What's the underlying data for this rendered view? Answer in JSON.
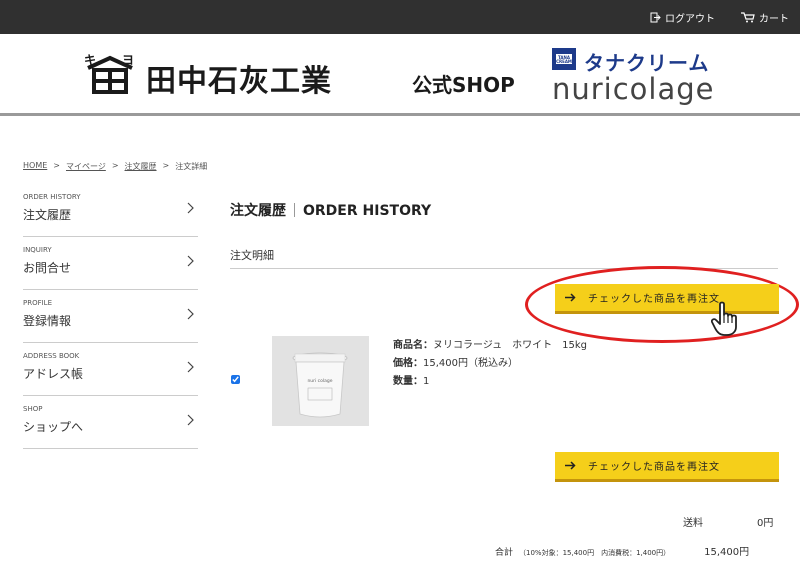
{
  "topbar": {
    "logout_label": "ログアウト",
    "cart_label": "カート"
  },
  "header": {
    "brand_mark_text": "キヨ",
    "brand_name": "田中石灰工業",
    "brand_shop": "公式SHOP",
    "tana_logo_text": "TANA CREAM",
    "tana_katakana": "タナクリーム",
    "nuricolage": "nuricolage"
  },
  "breadcrumb": {
    "items": [
      "HOME",
      "マイページ",
      "注文履歴",
      "注文詳細"
    ],
    "separator": ">"
  },
  "sidebar": {
    "items": [
      {
        "en": "ORDER HISTORY",
        "jp": "注文履歴"
      },
      {
        "en": "INQUIRY",
        "jp": "お問合せ"
      },
      {
        "en": "PROFILE",
        "jp": "登録情報"
      },
      {
        "en": "ADDRESS BOOK",
        "jp": "アドレス帳"
      },
      {
        "en": "SHOP",
        "jp": "ショップへ"
      }
    ]
  },
  "main": {
    "title_jp": "注文履歴",
    "title_en": "ORDER HISTORY",
    "subtitle": "注文明細",
    "reorder_label": "チェックした商品を再注文",
    "item": {
      "checked": true,
      "name_label": "商品名：",
      "name_value": "ヌリコラージュ　ホワイト　15kg",
      "price_label": "価格：",
      "price_value": "15,400円（税込み）",
      "qty_label": "数量：",
      "qty_value": "1",
      "image_text": "nuri colage"
    },
    "shipping_label": "送料",
    "shipping_value": "0円",
    "total_label": "合計",
    "total_detail": "（10%対象：15,400円　内消費税：1,400円）",
    "total_value": "15,400円"
  },
  "colors": {
    "topbar": "#303030",
    "button": "#f5cf1a",
    "highlight": "#e02020",
    "brand_blue": "#1d3a8a"
  }
}
